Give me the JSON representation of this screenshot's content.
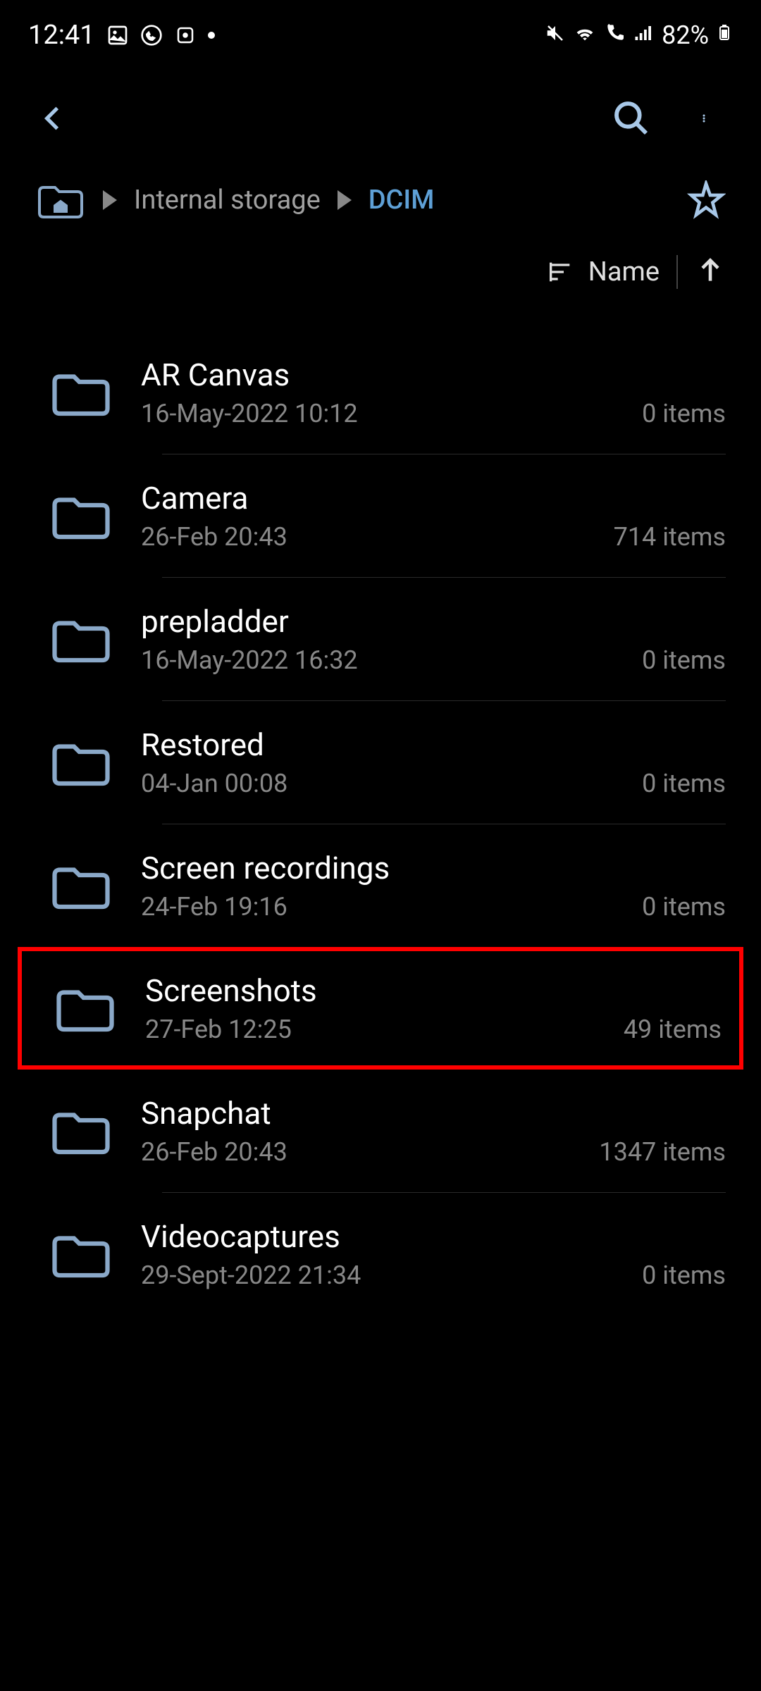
{
  "status": {
    "time": "12:41",
    "battery": "82%"
  },
  "breadcrumb": {
    "segment1": "Internal storage",
    "current": "DCIM"
  },
  "sort": {
    "label": "Name"
  },
  "folders": [
    {
      "name": "AR Canvas",
      "date": "16-May-2022 10:12",
      "count": "0 items",
      "highlighted": false
    },
    {
      "name": "Camera",
      "date": "26-Feb 20:43",
      "count": "714 items",
      "highlighted": false
    },
    {
      "name": "prepladder",
      "date": "16-May-2022 16:32",
      "count": "0 items",
      "highlighted": false
    },
    {
      "name": "Restored",
      "date": "04-Jan 00:08",
      "count": "0 items",
      "highlighted": false
    },
    {
      "name": "Screen recordings",
      "date": "24-Feb 19:16",
      "count": "0 items",
      "highlighted": false
    },
    {
      "name": "Screenshots",
      "date": "27-Feb 12:25",
      "count": "49 items",
      "highlighted": true
    },
    {
      "name": "Snapchat",
      "date": "26-Feb 20:43",
      "count": "1347 items",
      "highlighted": false
    },
    {
      "name": "Videocaptures",
      "date": "29-Sept-2022 21:34",
      "count": "0 items",
      "highlighted": false
    }
  ]
}
